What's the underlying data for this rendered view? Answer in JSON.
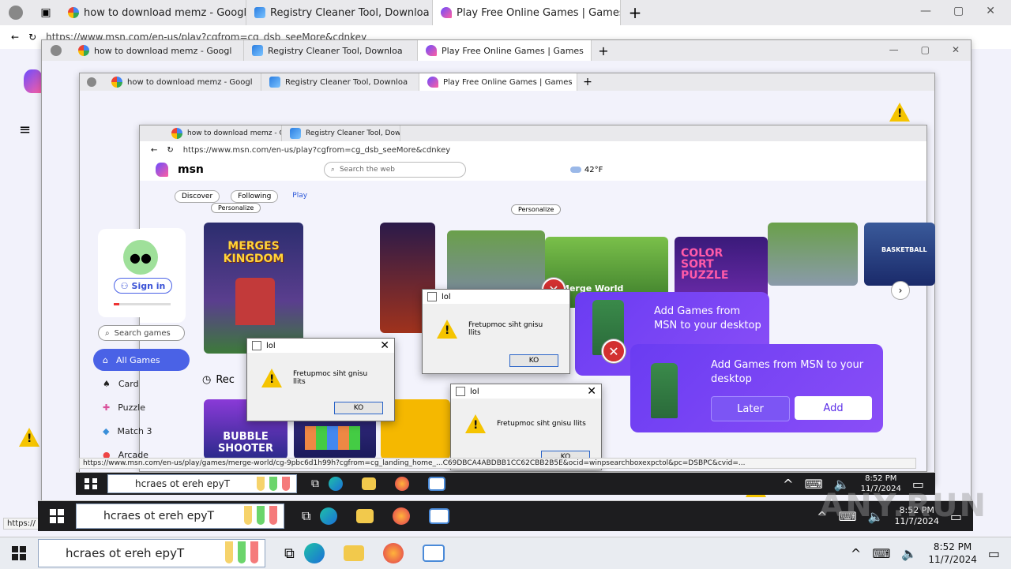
{
  "tabs": [
    {
      "title": "how to download memz - Googl",
      "icon": "google-icon"
    },
    {
      "title": "Registry Cleaner Tool, Downloa",
      "icon": "registry-icon"
    },
    {
      "title": "Play Free Online Games | Games",
      "icon": "msn-icon"
    }
  ],
  "address": {
    "url": "https://www.msn.com/en-us/play?cgfrom=cg_dsb_seeMore&cdnkey"
  },
  "msn": {
    "logo": "msn",
    "search_placeholder": "Search the web",
    "nav": [
      "Discover",
      "Following",
      "Play"
    ],
    "personalize": "Personalize",
    "weather": "42°F",
    "sign_in": "Sign in",
    "search_games": "Search games",
    "categories": [
      "All Games",
      "Card",
      "Puzzle",
      "Match 3",
      "Arcade"
    ],
    "game_tiles": [
      "MERGES KINGDOM",
      "COLOR SORT PUZZLE",
      "BUBBLE SHOOTER",
      "Merge World",
      "BASKETBALL"
    ],
    "recent_label": "Rec"
  },
  "promo": {
    "title": "Add Games from MSN to your desktop",
    "later": "Later",
    "add": "Add"
  },
  "dialog": {
    "title": "lol",
    "message": "Fretupmoc siht gnisu llits",
    "ok": "KO"
  },
  "status_url": "https://www.msn.com/en-us/play/games/merge-world/cg-9pbc6d1h99h?cgfrom=cg_landing_home_...C69DBCA4ABDBB1CC62CBB2B5E&ocid=winpsearchboxexpctol&pc=DSBPC&cvid=...",
  "taskbar": {
    "search": "hcraes ot ereh epyT",
    "time": "8:52 PM",
    "date": "11/7/2024"
  },
  "watermark": "ANY.RUN",
  "colors": {
    "accent": "#5b2ee8",
    "nav_active": "#4a62e6",
    "warning": "#f5c400",
    "error": "#d23030"
  }
}
